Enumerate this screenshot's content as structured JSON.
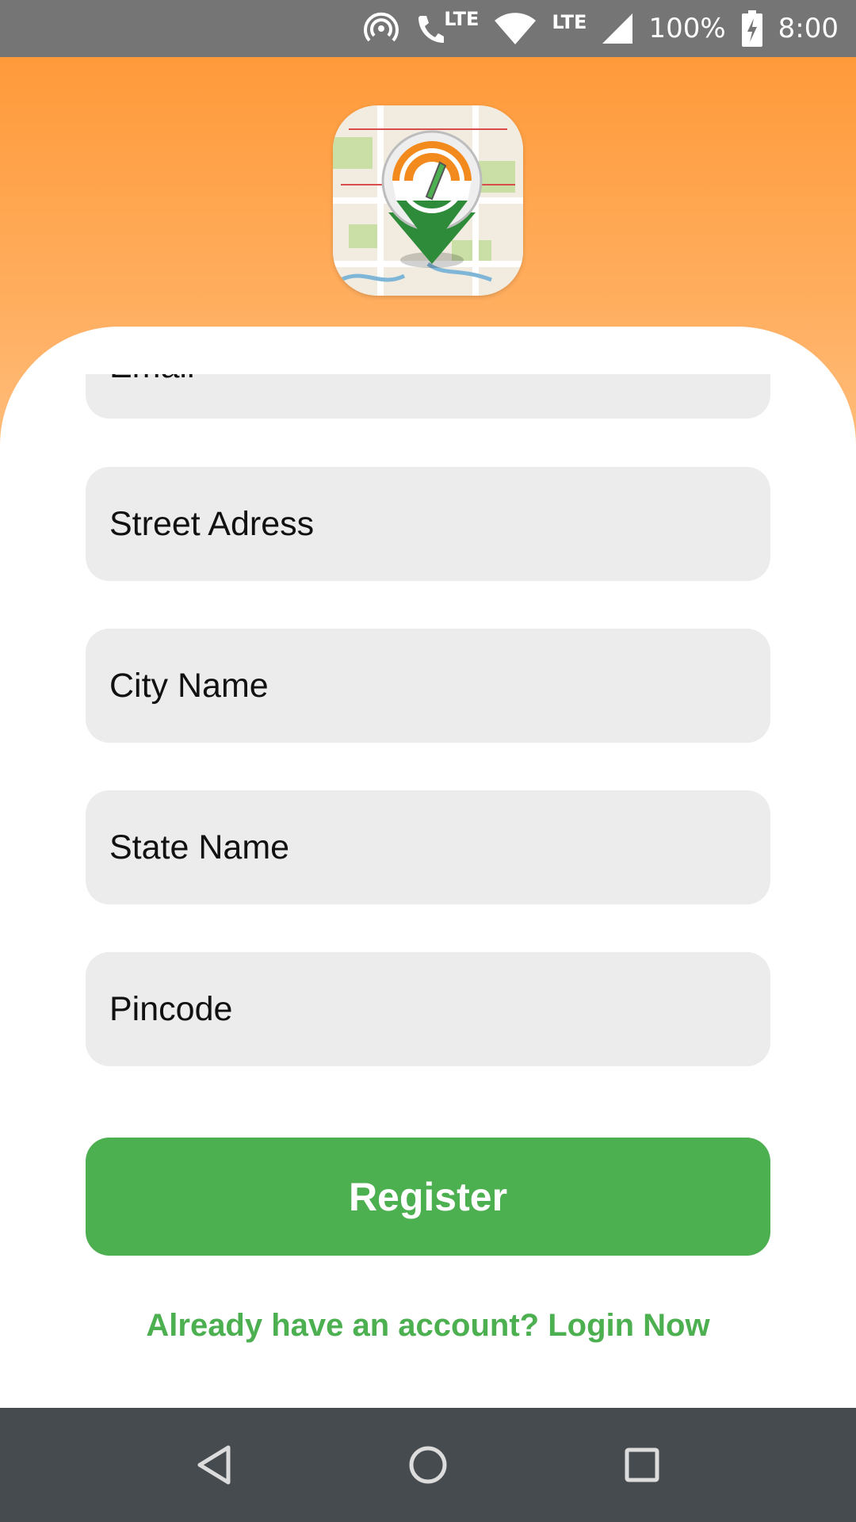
{
  "status_bar": {
    "lte_call": "LTE",
    "lte_data": "LTE",
    "battery": "100%",
    "time": "8:00",
    "icons": [
      "hotspot-icon",
      "phone-icon",
      "wifi-icon",
      "signal-icon",
      "battery-charging-icon"
    ]
  },
  "header": {
    "logo_icon": "map-pin-india-flag-logo",
    "gradient_color": "#ff9a3a"
  },
  "form": {
    "email_placeholder": "Email",
    "street_placeholder": "Street Adress",
    "city_placeholder": "City Name",
    "state_placeholder": "State Name",
    "pincode_placeholder": "Pincode",
    "register_label": "Register",
    "login_link": "Already have an account? Login Now"
  },
  "colors": {
    "accent": "#4caf50",
    "field_bg": "#ececec",
    "header": "#ff9a3a"
  },
  "nav_bar": {
    "icons": [
      "back-icon",
      "home-icon",
      "recents-icon"
    ]
  }
}
